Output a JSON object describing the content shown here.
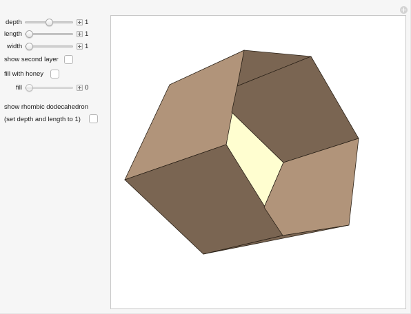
{
  "controls": {
    "depth": {
      "label": "depth",
      "value": "1",
      "fraction": 0.6
    },
    "length": {
      "label": "length",
      "value": "1",
      "fraction": 0.0
    },
    "width": {
      "label": "width",
      "value": "1",
      "fraction": 0.0
    },
    "show_second_layer": {
      "label": "show second layer",
      "checked": false
    },
    "fill_with_honey": {
      "label": "fill with honey",
      "checked": false
    },
    "fill": {
      "label": "fill",
      "value": "0",
      "fraction": 0.0
    },
    "rhombic": {
      "label_line1": "show rhombic dodecahedron",
      "label_line2": "(set depth and length to 1)",
      "checked": false
    }
  },
  "viewport": {
    "shape": "hexagonal honeycomb cell (open top view)",
    "colors": {
      "face_light": "#b1947a",
      "face_dark": "#7a6552",
      "inner_fill": "#fffed0",
      "edge": "#2b2218"
    }
  }
}
